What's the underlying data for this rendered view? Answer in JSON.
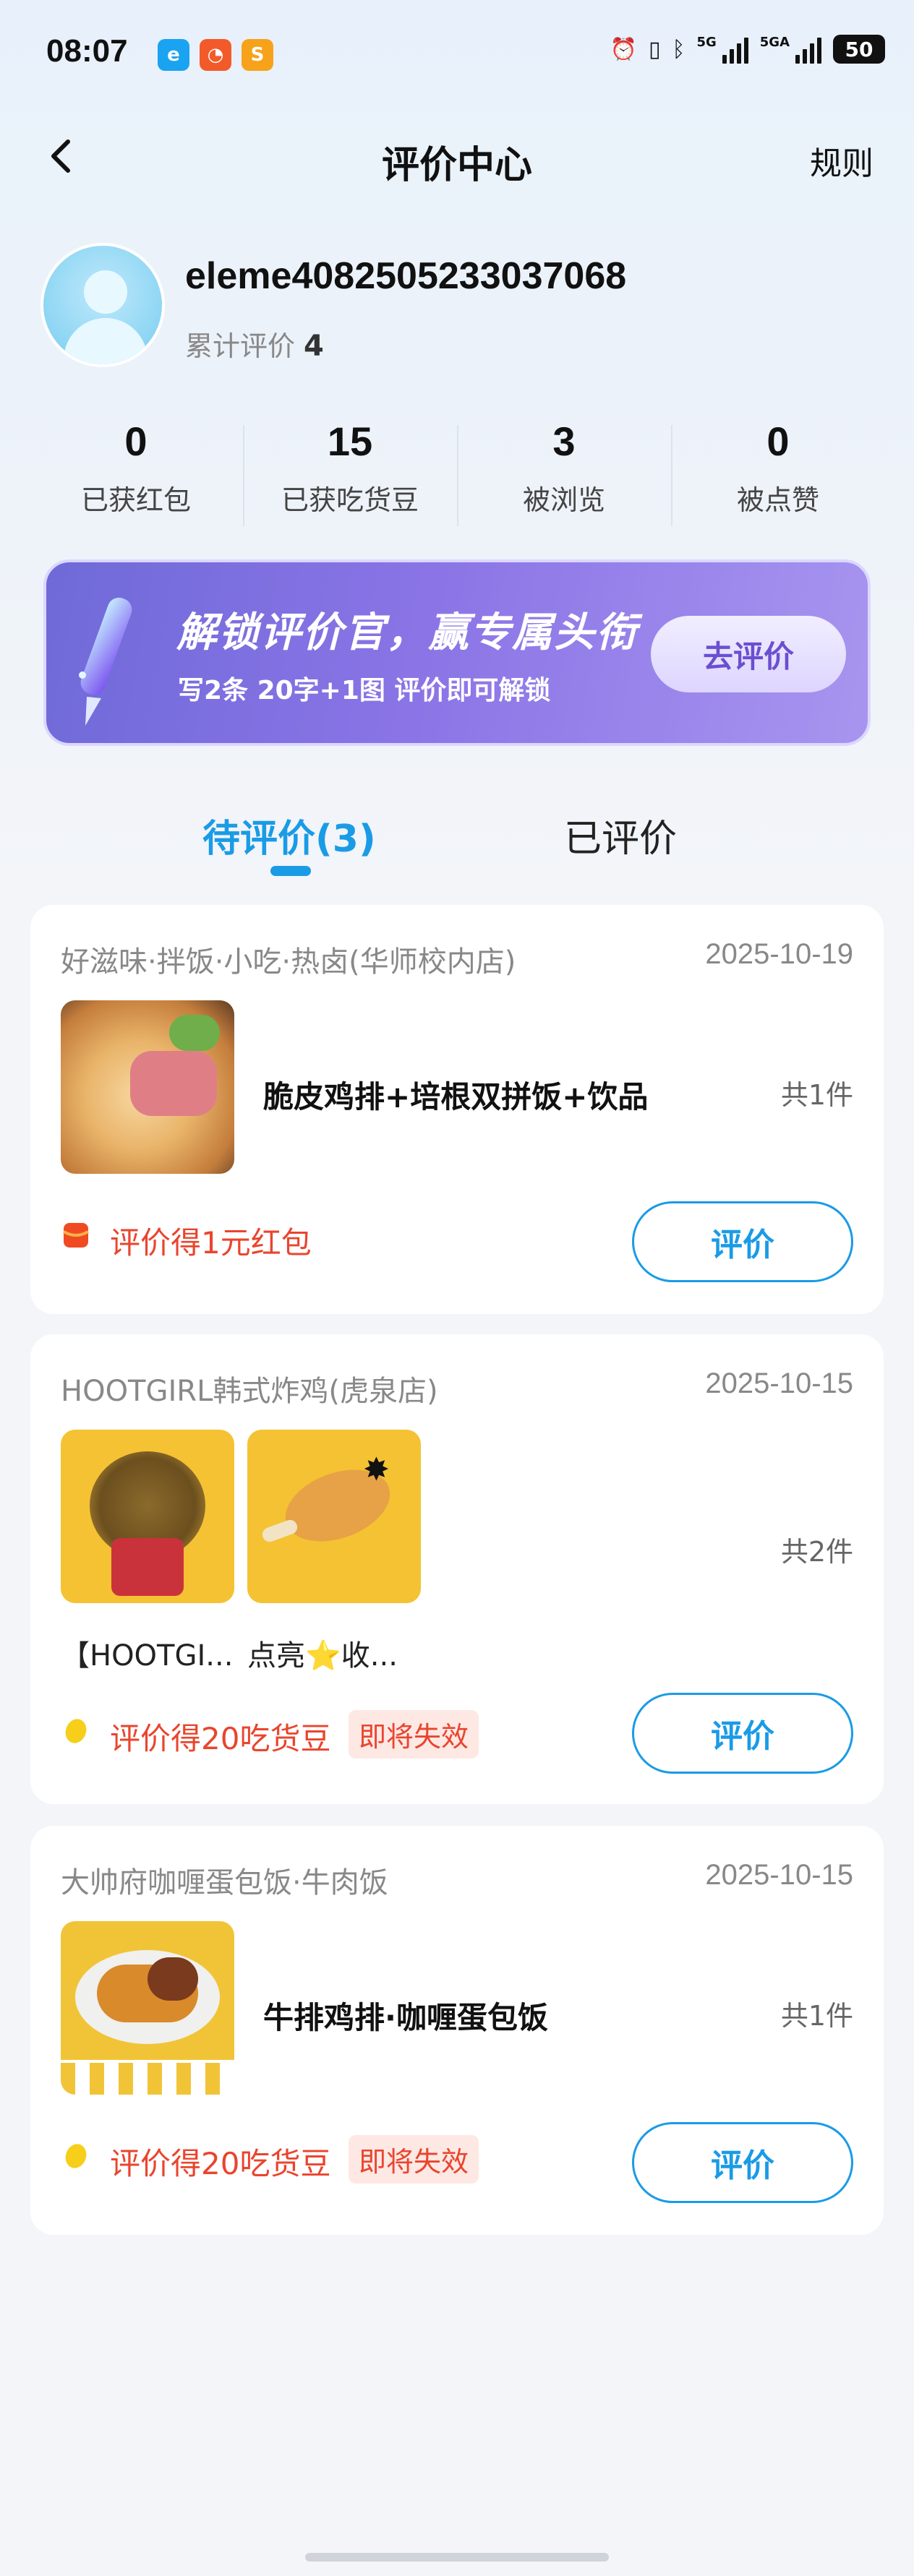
{
  "status_bar": {
    "time": "08:07",
    "network_1": "5G",
    "network_2": "5GA",
    "battery": "50"
  },
  "nav": {
    "title": "评价中心",
    "rule_label": "规则"
  },
  "profile": {
    "username": "eleme4082505233037068",
    "total_label": "累计评价",
    "total_value": "4"
  },
  "stats": [
    {
      "value": "0",
      "label": "已获红包"
    },
    {
      "value": "15",
      "label": "已获吃货豆"
    },
    {
      "value": "3",
      "label": "被浏览"
    },
    {
      "value": "0",
      "label": "被点赞"
    }
  ],
  "banner": {
    "title": "解锁评价官，赢专属头衔",
    "subtitle": "写2条 20字+1图 评价即可解锁",
    "button": "去评价"
  },
  "tabs": [
    {
      "label": "待评价(3)",
      "active": true
    },
    {
      "label": "已评价",
      "active": false
    }
  ],
  "orders": [
    {
      "shop": "好滋味·拌饭·小吃·热卤(华师校内店)",
      "date": "2025-10-19",
      "product": "脆皮鸡排+培根双拼饭+饮品",
      "qty": "共1件",
      "reward": "评价得1元红包",
      "reward_icon": "red-packet-icon",
      "button": "评价"
    },
    {
      "shop": "HOOTGIRL韩式炸鸡(虎泉店)",
      "date": "2025-10-15",
      "items": [
        "【HOOTGI...",
        "点亮⭐收..."
      ],
      "qty": "共2件",
      "reward": "评价得20吃货豆",
      "reward_icon": "bean-icon",
      "expire": "即将失效",
      "button": "评价"
    },
    {
      "shop": "大帅府咖喱蛋包饭·牛肉饭",
      "date": "2025-10-15",
      "product": "牛排鸡排·咖喱蛋包饭",
      "qty": "共1件",
      "reward": "评价得20吃货豆",
      "reward_icon": "bean-icon",
      "expire": "即将失效",
      "button": "评价"
    }
  ],
  "colors": {
    "accent": "#1a9be6",
    "reward": "#e9452e",
    "banner_start": "#6f6ad8",
    "banner_end": "#a795ef"
  }
}
